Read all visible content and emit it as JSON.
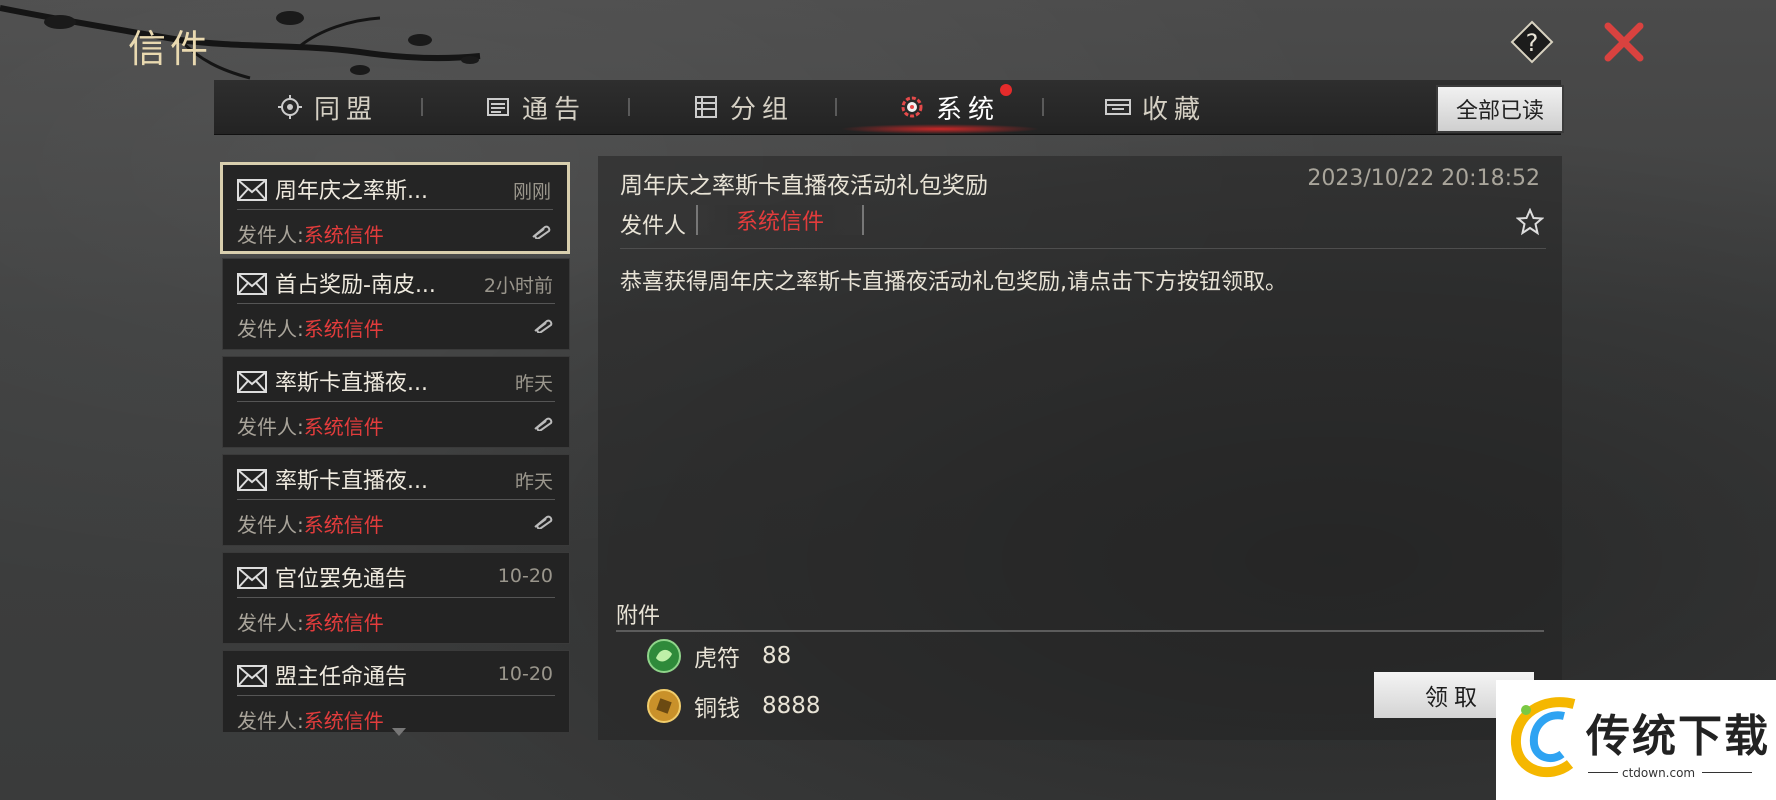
{
  "window": {
    "title": "信件"
  },
  "tabs": [
    {
      "label": "同盟",
      "icon": "alliance-icon"
    },
    {
      "label": "通告",
      "icon": "notice-icon"
    },
    {
      "label": "分组",
      "icon": "group-icon"
    },
    {
      "label": "系统",
      "icon": "system-gear-icon",
      "active": true,
      "badge": "red-dot"
    },
    {
      "label": "收藏",
      "icon": "favorite-box-icon"
    }
  ],
  "read_all_label": "全部已读",
  "mail_list": {
    "sender_label": "发件人:",
    "items": [
      {
        "title": "周年庆之率斯...",
        "time": "刚刚",
        "sender": "系统信件",
        "selected": true,
        "has_attachment": true
      },
      {
        "title": "首占奖励-南皮...",
        "time": "2小时前",
        "sender": "系统信件",
        "has_attachment": true
      },
      {
        "title": "率斯卡直播夜...",
        "time": "昨天",
        "sender": "系统信件",
        "has_attachment": true
      },
      {
        "title": "率斯卡直播夜...",
        "time": "昨天",
        "sender": "系统信件",
        "has_attachment": true
      },
      {
        "title": "官位罢免通告",
        "time": "10-20",
        "sender": "系统信件",
        "has_attachment": false
      },
      {
        "title": "盟主任命通告",
        "time": "10-20",
        "sender": "系统信件",
        "has_attachment": false
      }
    ]
  },
  "detail": {
    "title": "周年庆之率斯卡直播夜活动礼包奖励",
    "datetime": "2023/10/22 20:18:52",
    "sender_label": "发件人",
    "sender": "系统信件",
    "body": "恭喜获得周年庆之率斯卡直播夜活动礼包奖励,请点击下方按钮领取。",
    "attachments_title": "附件",
    "attachments": [
      {
        "name": "虎符",
        "qty": "88",
        "icon": "tiger-tally-icon"
      },
      {
        "name": "铜钱",
        "qty": "8888",
        "icon": "copper-coin-icon"
      }
    ],
    "claim_label": "领取"
  },
  "watermark": {
    "text": "传统下载",
    "url": "ctdown.com"
  },
  "colors": {
    "accent_red": "#e33c3c",
    "panel": "#232323",
    "gold": "#e9d9b0"
  }
}
